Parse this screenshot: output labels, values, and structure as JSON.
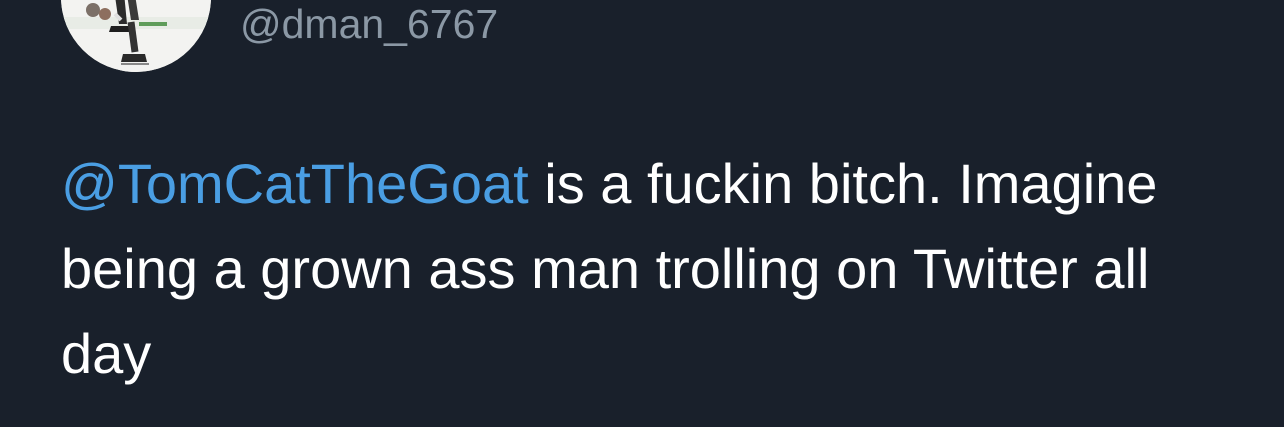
{
  "author": {
    "handle": "@dman_6767",
    "avatar_icon": "hockey-player-avatar"
  },
  "tweet": {
    "mention": "@TomCatTheGoat",
    "text_rest": " is a fuckin bitch. Imagine being a grown ass man trolling on Twitter all day"
  },
  "colors": {
    "background": "#19202b",
    "mention": "#4a9ee3",
    "handle": "#8b98a5",
    "text": "#ffffff"
  }
}
